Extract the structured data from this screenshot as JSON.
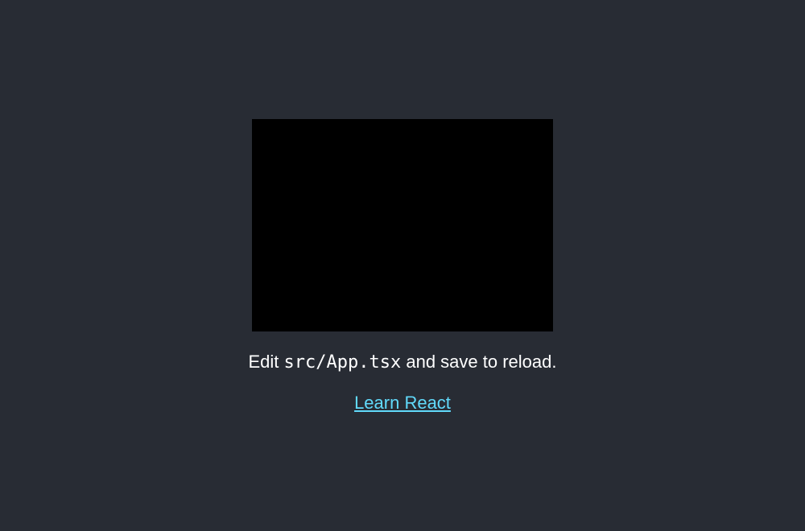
{
  "header": {
    "logo_name": "react-logo",
    "instructions": {
      "prefix": "Edit ",
      "code": "src/App.tsx",
      "suffix": " and save to reload."
    },
    "link_label": "Learn React"
  },
  "colors": {
    "background": "#282c34",
    "text": "#ffffff",
    "link": "#61dafb",
    "logo_box": "#000000"
  }
}
